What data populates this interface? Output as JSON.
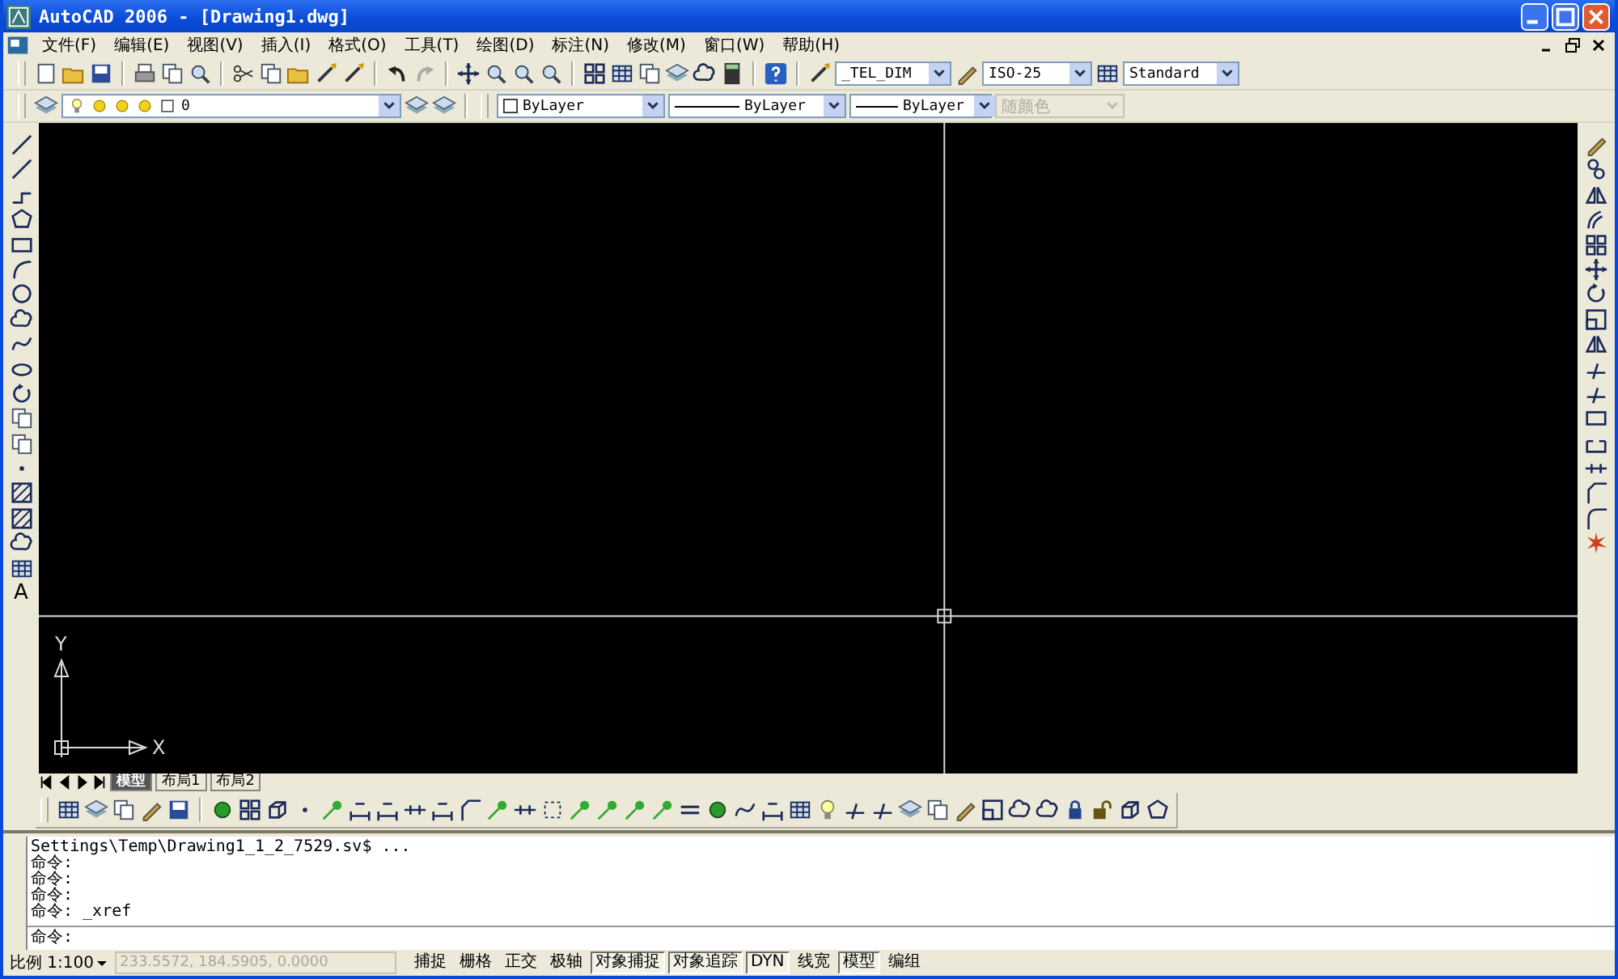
{
  "window": {
    "title": "AutoCAD 2006 - [Drawing1.dwg]"
  },
  "menu": [
    {
      "label": "文件(F)"
    },
    {
      "label": "编辑(E)"
    },
    {
      "label": "视图(V)"
    },
    {
      "label": "插入(I)"
    },
    {
      "label": "格式(O)"
    },
    {
      "label": "工具(T)"
    },
    {
      "label": "绘图(D)"
    },
    {
      "label": "标注(N)"
    },
    {
      "label": "修改(M)"
    },
    {
      "label": "窗口(W)"
    },
    {
      "label": "帮助(H)"
    }
  ],
  "styles_toolbar": {
    "text_style": "_TEL_DIM",
    "dim_style": "ISO-25",
    "table_style": "Standard"
  },
  "layers_toolbar": {
    "layer": "0"
  },
  "properties_toolbar": {
    "color_setting": "ByLayer",
    "linetype": "ByLayer",
    "lineweight": "ByLayer",
    "plot_style": {
      "value": "随颜色",
      "disabled": true
    }
  },
  "left_toolbar": {
    "text_tool": "A"
  },
  "canvas": {
    "ucs": {
      "x_label": "X",
      "y_label": "Y"
    }
  },
  "layout_tabs": [
    {
      "label": "模型",
      "selected": true
    },
    {
      "label": "布局1",
      "selected": false
    },
    {
      "label": "布局2",
      "selected": false
    }
  ],
  "command_history": [
    "Settings\\Temp\\Drawing1_1_2_7529.sv$ ...",
    "命令:",
    "命令:",
    "命令:",
    "命令: _xref"
  ],
  "command_prompt": "命令:",
  "status_bar": {
    "scale": "比例 1:100",
    "coordinates": "233.5572, 184.5905, 0.0000",
    "toggles": [
      {
        "label": "捕捉",
        "on": false
      },
      {
        "label": "栅格",
        "on": false
      },
      {
        "label": "正交",
        "on": false
      },
      {
        "label": "极轴",
        "on": false
      },
      {
        "label": "对象捕捉",
        "on": true
      },
      {
        "label": "对象追踪",
        "on": true
      },
      {
        "label": "DYN",
        "on": true
      },
      {
        "label": "线宽",
        "on": false
      },
      {
        "label": "模型",
        "on": true
      },
      {
        "label": "编组",
        "on": false
      }
    ]
  }
}
